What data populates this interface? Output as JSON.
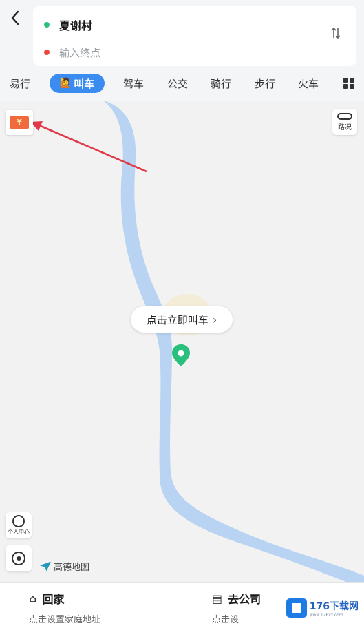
{
  "header": {
    "back_icon": "chevron-left-icon",
    "start": "夏谢村",
    "end_placeholder": "输入终点",
    "swap_icon": "swap-vertical-icon"
  },
  "tabs": {
    "items": [
      "易行",
      "叫车",
      "驾车",
      "公交",
      "骑行",
      "步行",
      "火车"
    ],
    "active": "叫车",
    "more_icon": "grid-icon"
  },
  "map": {
    "coupon_icon": "coupon-icon",
    "traffic_label": "路况",
    "call_prompt": "点击立即叫车",
    "user_center_label": "个人中心",
    "locate_icon": "locate-icon",
    "brand": "高德地图",
    "river_color": "#b8d4f2",
    "pin_color": "#2bbf7d"
  },
  "shortcuts": {
    "home_title": "回家",
    "home_sub": "点击设置家庭地址",
    "work_title": "去公司",
    "work_sub": "点击设"
  },
  "watermark": {
    "text": "176下载网",
    "sub": "www.176xz.com"
  }
}
